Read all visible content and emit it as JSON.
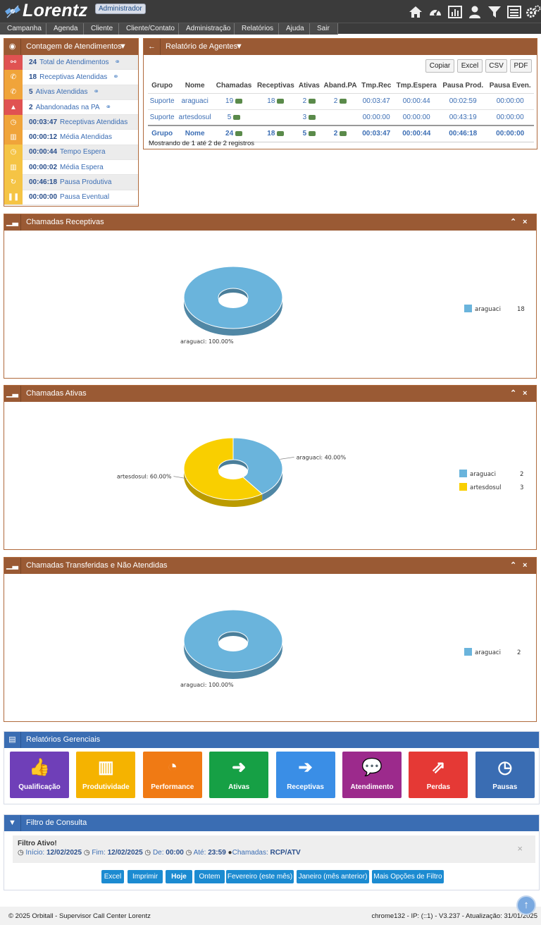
{
  "app": {
    "title": "Lorentz",
    "role_badge": "Administrador"
  },
  "menu": [
    "Campanha",
    "Agenda",
    "Cliente",
    "Cliente/Contato",
    "Administração",
    "Relatórios",
    "Ajuda",
    "Sair"
  ],
  "top_icons": [
    "home-icon",
    "dashboard-gauge-icon",
    "bar-chart-icon",
    "user-icon",
    "filter-icon",
    "list-icon",
    "gears-icon"
  ],
  "contagem": {
    "title": "Contagem de Atendimentos",
    "rows": [
      {
        "value": "24",
        "label": "Total de Atendimentos",
        "icon": "sitemap-icon",
        "color": "#e05252"
      },
      {
        "value": "18",
        "label": "Receptivas Atendidas",
        "icon": "phone-icon",
        "color": "#f0a43a"
      },
      {
        "value": "5",
        "label": "Ativas Atendidas",
        "icon": "phone-icon",
        "color": "#f0a43a"
      },
      {
        "value": "2",
        "label": "Abandonadas na PA",
        "icon": "warning-icon",
        "color": "#e05252"
      },
      {
        "value": "00:03:47",
        "label": "Receptivas Atendidas",
        "icon": "clock-icon",
        "color": "#f0a43a"
      },
      {
        "value": "00:00:12",
        "label": "Média Atendidas",
        "icon": "bar-chart-icon",
        "color": "#f0a43a"
      },
      {
        "value": "00:00:44",
        "label": "Tempo Espera",
        "icon": "clock-icon",
        "color": "#f5c445"
      },
      {
        "value": "00:00:02",
        "label": "Média Espera",
        "icon": "bar-chart-icon",
        "color": "#f5c445"
      },
      {
        "value": "00:46:18",
        "label": "Pausa Produtiva",
        "icon": "refresh-icon",
        "color": "#f5c445"
      },
      {
        "value": "00:00:00",
        "label": "Pausa Eventual",
        "icon": "pause-icon",
        "color": "#f5c445"
      }
    ]
  },
  "agentes": {
    "title": "Relatório de Agentes",
    "buttons": [
      "Copiar",
      "Excel",
      "CSV",
      "PDF"
    ],
    "columns": [
      "Grupo",
      "Nome",
      "Chamadas",
      "Receptivas",
      "Ativas",
      "Aband.PA",
      "Tmp.Rec",
      "Tmp.Espera",
      "Pausa Prod.",
      "Pausa Even."
    ],
    "rows": [
      [
        "Suporte",
        "araguaci",
        "19",
        "18",
        "2",
        "2",
        "00:03:47",
        "00:00:44",
        "00:02:59",
        "00:00:00"
      ],
      [
        "Suporte",
        "artesdosul",
        "5",
        "",
        "3",
        "",
        "00:00:00",
        "00:00:00",
        "00:43:19",
        "00:00:00"
      ]
    ],
    "totals": [
      "Grupo",
      "Nome",
      "24",
      "18",
      "5",
      "2",
      "00:03:47",
      "00:00:44",
      "00:46:18",
      "00:00:00"
    ],
    "info": "Mostrando de 1 até 2 de 2 registros"
  },
  "charts_titles": {
    "receptivas": "Chamadas Receptivas",
    "ativas": "Chamadas Ativas",
    "transferidas": "Chamadas Transferidas e Não Atendidas"
  },
  "chart_data": [
    {
      "type": "pie",
      "title": "Chamadas Receptivas",
      "categories": [
        "araguaci"
      ],
      "values": [
        18
      ],
      "colors": [
        "#6ab4dc"
      ],
      "slice_labels": [
        "araguaci: 100.00%"
      ],
      "legend": "right"
    },
    {
      "type": "pie",
      "title": "Chamadas Ativas",
      "categories": [
        "araguaci",
        "artesdosul"
      ],
      "values": [
        2,
        3
      ],
      "colors": [
        "#6ab4dc",
        "#f9cf00"
      ],
      "slice_labels": [
        "araguaci: 40.00%",
        "artesdosul: 60.00%"
      ],
      "legend": "right"
    },
    {
      "type": "pie",
      "title": "Chamadas Transferidas e Não Atendidas",
      "categories": [
        "araguaci"
      ],
      "values": [
        2
      ],
      "colors": [
        "#6ab4dc"
      ],
      "slice_labels": [
        "araguaci: 100.00%"
      ],
      "legend": "right"
    }
  ],
  "relatorios": {
    "title": "Relatórios Gerenciais",
    "buttons": [
      {
        "label": "Qualificação",
        "icon": "thumbs-up-icon",
        "color": "#6f3fb8"
      },
      {
        "label": "Produtividade",
        "icon": "bar-chart-icon",
        "color": "#f5b300"
      },
      {
        "label": "Performance",
        "icon": "dashboard-gauge-icon",
        "color": "#f07a14"
      },
      {
        "label": "Ativas",
        "icon": "sign-out-icon",
        "color": "#16a045"
      },
      {
        "label": "Receptivas",
        "icon": "sign-in-icon",
        "color": "#3a8ee6"
      },
      {
        "label": "Atendimento",
        "icon": "comments-icon",
        "color": "#9c2a8c"
      },
      {
        "label": "Perdas",
        "icon": "external-link-icon",
        "color": "#e53935"
      },
      {
        "label": "Pausas",
        "icon": "clock-icon",
        "color": "#3a6db3"
      }
    ]
  },
  "filtro": {
    "title": "Filtro de Consulta",
    "active_label": "Filtro Ativo!",
    "inicio_label": "Início:",
    "inicio": "12/02/2025",
    "fim_label": "Fim:",
    "fim": "12/02/2025",
    "de_label": "De:",
    "de": "00:00",
    "ate_label": "Até:",
    "ate": "23:59",
    "chamadas_label": "Chamadas:",
    "chamadas": "RCP/ATV",
    "buttons": [
      "Excel",
      "Imprimir",
      "Hoje",
      "Ontem",
      "Fevereiro (este mês)",
      "Janeiro (mês anterior)",
      "Mais Opções de Filtro"
    ]
  },
  "footer": {
    "left": "© 2025 Orbitall - Supervisor Call Center Lorentz",
    "right": "chrome132 - IP: (::1) - V3.237 - Atualização: 31/01/2025"
  }
}
